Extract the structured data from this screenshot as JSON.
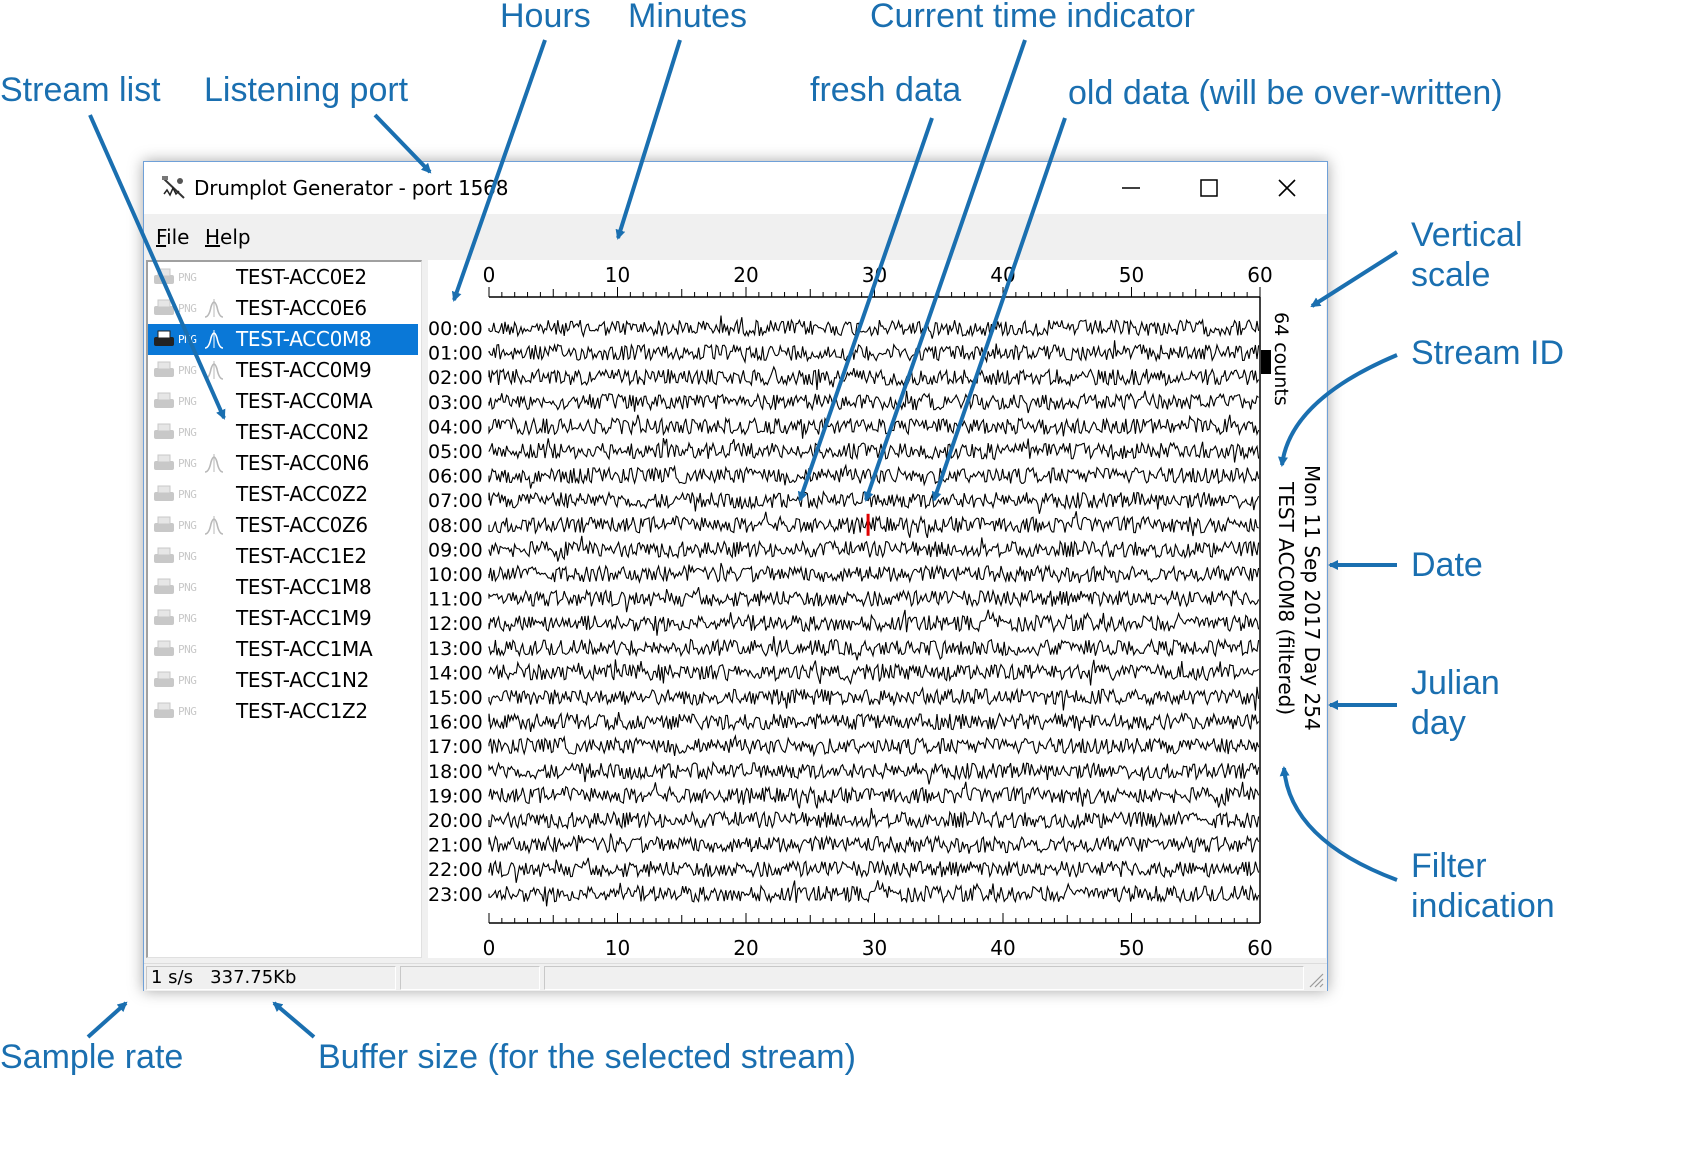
{
  "window": {
    "title": "Drumplot Generator - port 1568",
    "menu": [
      "File",
      "Help"
    ]
  },
  "streams": [
    {
      "name": "TEST-ACC0E2",
      "filter": false,
      "selected": false
    },
    {
      "name": "TEST-ACC0E6",
      "filter": true,
      "selected": false
    },
    {
      "name": "TEST-ACC0M8",
      "filter": true,
      "selected": true
    },
    {
      "name": "TEST-ACC0M9",
      "filter": true,
      "selected": false
    },
    {
      "name": "TEST-ACC0MA",
      "filter": false,
      "selected": false
    },
    {
      "name": "TEST-ACC0N2",
      "filter": false,
      "selected": false
    },
    {
      "name": "TEST-ACC0N6",
      "filter": true,
      "selected": false
    },
    {
      "name": "TEST-ACC0Z2",
      "filter": false,
      "selected": false
    },
    {
      "name": "TEST-ACC0Z6",
      "filter": true,
      "selected": false
    },
    {
      "name": "TEST-ACC1E2",
      "filter": false,
      "selected": false
    },
    {
      "name": "TEST-ACC1M8",
      "filter": false,
      "selected": false
    },
    {
      "name": "TEST-ACC1M9",
      "filter": false,
      "selected": false
    },
    {
      "name": "TEST-ACC1MA",
      "filter": false,
      "selected": false
    },
    {
      "name": "TEST-ACC1N2",
      "filter": false,
      "selected": false
    },
    {
      "name": "TEST-ACC1Z2",
      "filter": false,
      "selected": false
    }
  ],
  "png_label": "PNG",
  "drumplot": {
    "minute_ticks": [
      "0",
      "10",
      "20",
      "30",
      "40",
      "50",
      "60"
    ],
    "minute_range": [
      0,
      60
    ],
    "hour_labels": [
      "00:00",
      "01:00",
      "02:00",
      "03:00",
      "04:00",
      "05:00",
      "06:00",
      "07:00",
      "08:00",
      "09:00",
      "10:00",
      "11:00",
      "12:00",
      "13:00",
      "14:00",
      "15:00",
      "16:00",
      "17:00",
      "18:00",
      "19:00",
      "20:00",
      "21:00",
      "22:00",
      "23:00"
    ],
    "current_time": {
      "hour_index": 8,
      "minute": 29.5
    },
    "vertical_scale": "64 counts",
    "date": "Mon 11 Sep 2017",
    "julian_day": "Day 254",
    "stream_id": "TEST ACC0M8 (filtered)",
    "trace_color": "#000000",
    "indicator_color": "#e00000"
  },
  "status": {
    "sample_rate": "1 s/s",
    "buffer_size": "337.75Kb"
  },
  "annotations": {
    "hours": "Hours",
    "minutes": "Minutes",
    "current_time": "Current time indicator",
    "stream_list": "Stream list",
    "listening_port": "Listening port",
    "fresh_data": "fresh data",
    "old_data": "old data (will be over-written)",
    "vertical_scale_1": "Vertical",
    "vertical_scale_2": "scale",
    "stream_id": "Stream ID",
    "date": "Date",
    "julian_1": "Julian",
    "julian_2": "day",
    "filter_1": "Filter",
    "filter_2": "indication",
    "sample_rate": "Sample rate",
    "buffer_size": "Buffer size (for the selected stream)"
  },
  "colors": {
    "annotation": "#1a6fb0",
    "selection": "#0a78d7"
  }
}
